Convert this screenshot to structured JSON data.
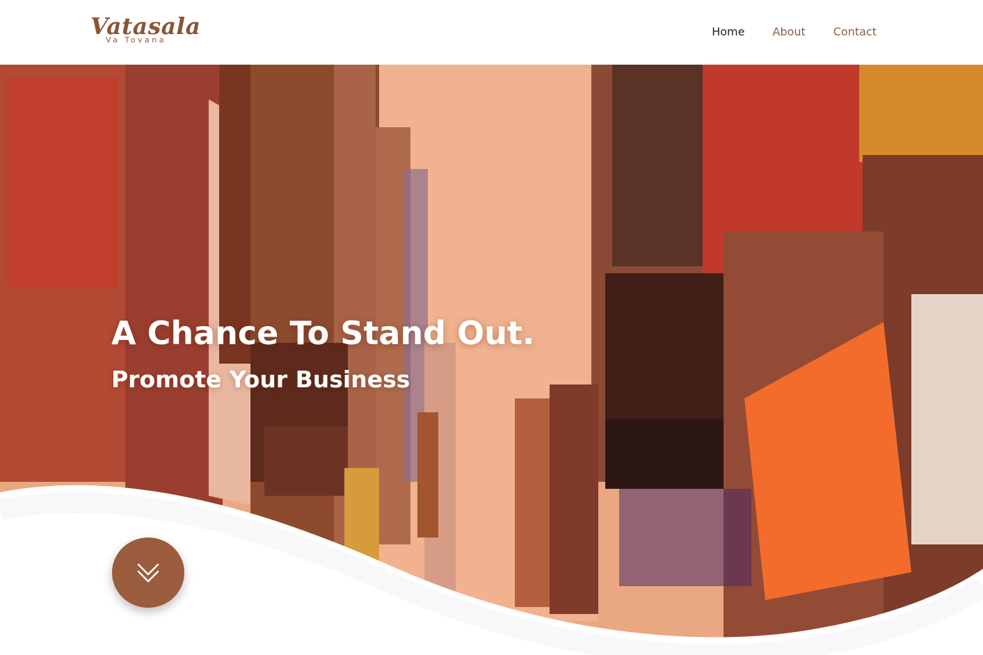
{
  "brand": {
    "name": "Vatasala",
    "tagline": "Va Tovana",
    "color": "#8b5535"
  },
  "nav": {
    "items": [
      {
        "label": "Home",
        "active": true
      },
      {
        "label": "About",
        "active": false
      },
      {
        "label": "Contact",
        "active": false
      }
    ]
  },
  "hero": {
    "title": "A Chance To Stand Out.",
    "subtitle": "Promote Your Business",
    "overlay_color": "#e8a07a",
    "scroll_button_icon": "double-chevron-down-icon",
    "scroll_button_color": "#9a5c3c"
  }
}
